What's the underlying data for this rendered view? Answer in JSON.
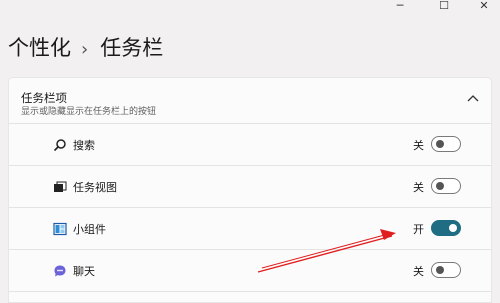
{
  "window": {
    "minimize_glyph": "─",
    "maximize_glyph": "☐",
    "close_glyph": "✕"
  },
  "breadcrumb": {
    "parent": "个性化",
    "separator": "›",
    "current": "任务栏"
  },
  "section": {
    "title": "任务栏项",
    "subtitle": "显示或隐藏显示在任务栏上的按钮",
    "expanded": true
  },
  "items": [
    {
      "label": "搜索",
      "icon": "search-icon",
      "state": "关",
      "on": false
    },
    {
      "label": "任务视图",
      "icon": "task-view-icon",
      "state": "关",
      "on": false
    },
    {
      "label": "小组件",
      "icon": "widgets-icon",
      "state": "开",
      "on": true
    },
    {
      "label": "聊天",
      "icon": "chat-icon",
      "state": "关",
      "on": false
    }
  ],
  "colors": {
    "accent": "#1e6d82",
    "arrow": "#e02020",
    "chat_icon": "#6b63d8"
  }
}
